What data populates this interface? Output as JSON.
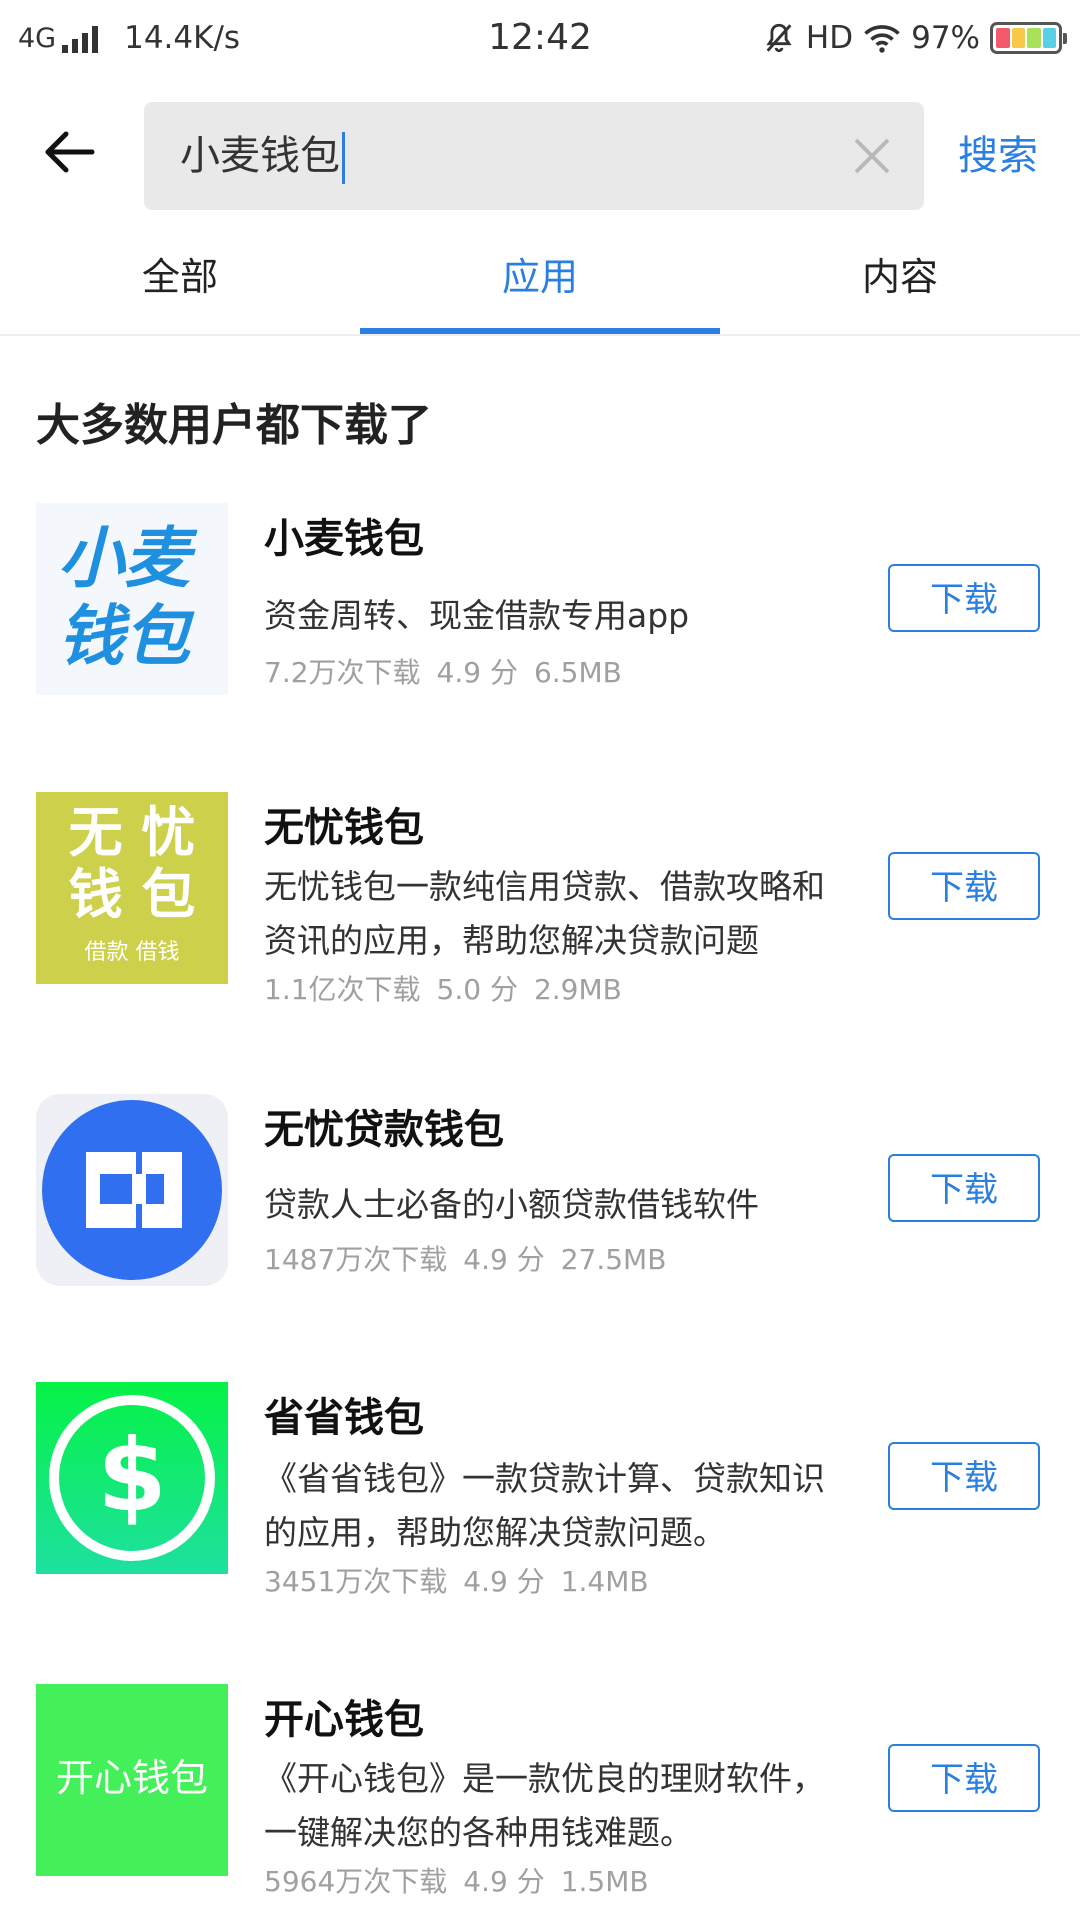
{
  "status_bar": {
    "network": "4G",
    "speed": "14.4K/s",
    "time": "12:42",
    "hd": "HD",
    "battery": "97%"
  },
  "search": {
    "query": "小麦钱包",
    "button_label": "搜索"
  },
  "tabs": [
    {
      "label": "全部",
      "active": false
    },
    {
      "label": "应用",
      "active": true
    },
    {
      "label": "内容",
      "active": false
    }
  ],
  "section": {
    "title": "大多数用户都下载了"
  },
  "apps": [
    {
      "name": "小麦钱包",
      "description": "资金周转、现金借款专用app",
      "downloads": "7.2万次下载",
      "rating": "4.9 分",
      "size": "6.5MB",
      "button": "下载",
      "icon": {
        "type": "text-logo",
        "line1": "小麦",
        "line2": "钱包",
        "color": "#1f8fe0"
      }
    },
    {
      "name": "无忧钱包",
      "description": "无忧钱包一款纯信用贷款、借款攻略和资讯的应用，帮助您解决贷款问题",
      "downloads": "1.1亿次下载",
      "rating": "5.0 分",
      "size": "2.9MB",
      "button": "下载",
      "icon": {
        "type": "text-logo",
        "line1": "无 忧",
        "line2": "钱 包",
        "line3": "借款 借钱",
        "color": "#cdd04a"
      }
    },
    {
      "name": "无忧贷款钱包",
      "description": "贷款人士必备的小额贷款借钱软件",
      "downloads": "1487万次下载",
      "rating": "4.9 分",
      "size": "27.5MB",
      "button": "下载",
      "icon": {
        "type": "circle-logo",
        "color": "#2f6ff0"
      }
    },
    {
      "name": "省省钱包",
      "description": "《省省钱包》一款贷款计算、贷款知识的应用，帮助您解决贷款问题。",
      "downloads": "3451万次下载",
      "rating": "4.9 分",
      "size": "1.4MB",
      "button": "下载",
      "icon": {
        "type": "dollar-logo",
        "color": "#12e888"
      }
    },
    {
      "name": "开心钱包",
      "description": "《开心钱包》是一款优良的理财软件，一键解决您的各种用钱难题。",
      "downloads": "5964万次下载",
      "rating": "4.9 分",
      "size": "1.5MB",
      "button": "下载",
      "icon": {
        "type": "text-logo",
        "line1": "开心钱包",
        "color": "#43f05a"
      }
    }
  ]
}
